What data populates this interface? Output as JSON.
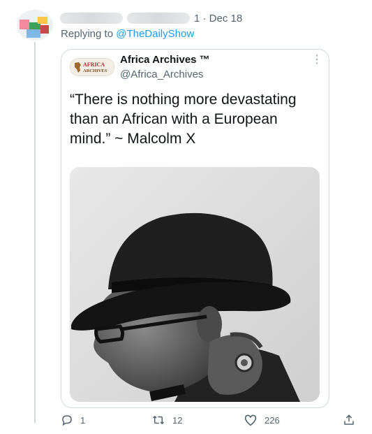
{
  "tweet": {
    "timestamp": "1 · Dec 18",
    "replying_prefix": "Replying to",
    "replying_handle": "@TheDailyShow"
  },
  "quoted": {
    "logo_text": "AFRICA ARCHIVES",
    "name": "Africa Archives ™",
    "handle": "@Africa_Archives",
    "more": "⋮",
    "text": "“There is nothing more devastating than an African with a European mind.” ~ Malcolm X"
  },
  "actions": {
    "reply_count": "1",
    "retweet_count": "12",
    "like_count": "226"
  },
  "icons": [
    "avatar",
    "kebab-icon",
    "reply-icon",
    "retweet-icon",
    "like-icon",
    "share-icon"
  ],
  "colors": {
    "link": "#1d9bf0",
    "muted": "#536471",
    "border": "#cfd9de"
  }
}
